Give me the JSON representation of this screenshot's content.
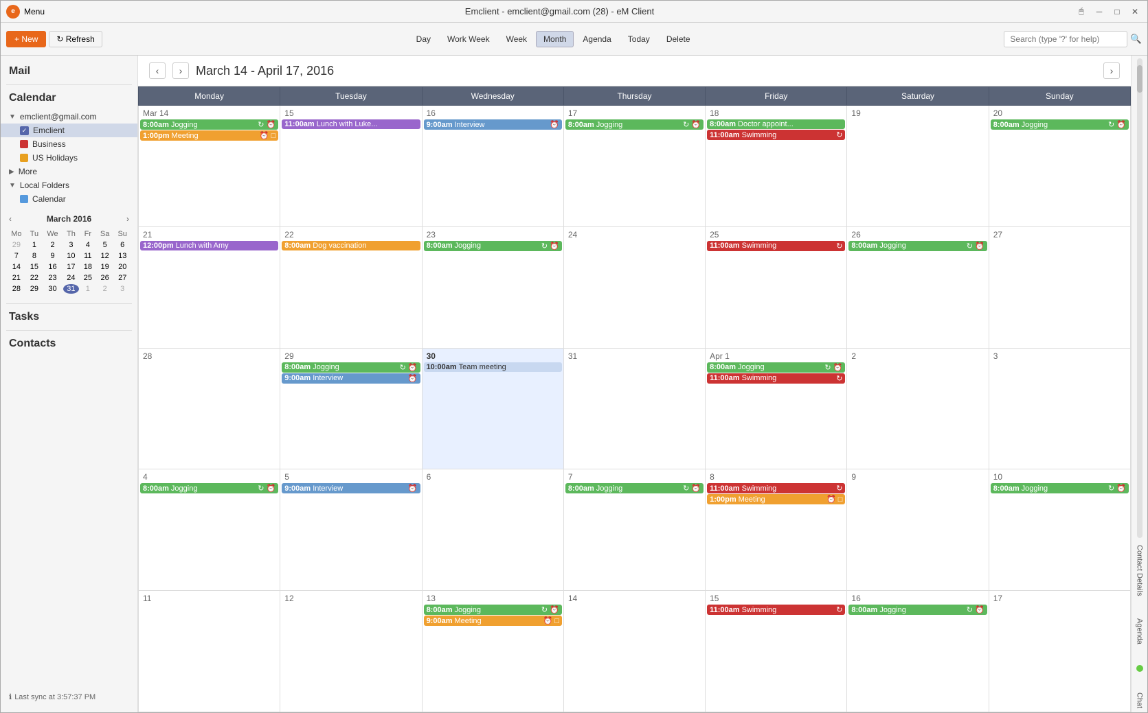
{
  "titleBar": {
    "appName": "eM Client",
    "title": "Emclient - emclient@gmail.com (28) - eM Client",
    "menuLabel": "Menu"
  },
  "toolbar": {
    "newLabel": "+ New",
    "refreshLabel": "↻ Refresh",
    "dayLabel": "Day",
    "workWeekLabel": "Work Week",
    "weekLabel": "Week",
    "monthLabel": "Month",
    "agendaLabel": "Agenda",
    "todayLabel": "Today",
    "deleteLabel": "Delete",
    "searchPlaceholder": "Search (type '?' for help)"
  },
  "sidebar": {
    "mailLabel": "Mail",
    "calendarLabel": "Calendar",
    "accountEmail": "emclient@gmail.com",
    "calendars": [
      {
        "name": "Emclient",
        "color": "#5566aa",
        "checked": true
      },
      {
        "name": "Business",
        "color": "#cc3333",
        "checked": true
      },
      {
        "name": "US Holidays",
        "color": "#e8a020",
        "checked": true
      }
    ],
    "moreLabel": "More",
    "localFoldersLabel": "Local Folders",
    "localCalendars": [
      {
        "name": "Calendar",
        "color": "#5599dd",
        "checked": true
      }
    ],
    "tasksLabel": "Tasks",
    "contactsLabel": "Contacts",
    "miniCal": {
      "title": "March 2016",
      "headers": [
        "Mo",
        "Tu",
        "We",
        "Th",
        "Fr",
        "Sa",
        "Su"
      ],
      "rows": [
        [
          "29",
          "1",
          "2",
          "3",
          "4",
          "5",
          "6"
        ],
        [
          "7",
          "8",
          "9",
          "10",
          "11",
          "12",
          "13"
        ],
        [
          "14",
          "15",
          "16",
          "17",
          "18",
          "19",
          "20"
        ],
        [
          "21",
          "22",
          "23",
          "24",
          "25",
          "26",
          "27"
        ],
        [
          "28",
          "29",
          "30",
          "31",
          "1",
          "2",
          "3"
        ]
      ],
      "today": "31"
    },
    "syncStatus": "Last sync at 3:57:37 PM"
  },
  "calendar": {
    "rangeTitle": "March 14 - April 17, 2016",
    "dayHeaders": [
      "Monday",
      "Tuesday",
      "Wednesday",
      "Thursday",
      "Friday",
      "Saturday",
      "Sunday"
    ],
    "weeks": [
      {
        "days": [
          {
            "date": "Mar 14",
            "events": [
              {
                "time": "8:00am",
                "title": "Jogging",
                "color": "green",
                "icons": [
                  "↻",
                  "⏰"
                ]
              },
              {
                "time": "1:00pm",
                "title": "Meeting",
                "color": "orange",
                "icons": [
                  "⏰",
                  "□"
                ]
              }
            ]
          },
          {
            "date": "15",
            "events": [
              {
                "time": "11:00am",
                "title": "Lunch with Luke...",
                "color": "purple",
                "icons": []
              }
            ]
          },
          {
            "date": "16",
            "events": [
              {
                "time": "9:00am",
                "title": "Interview",
                "color": "blue",
                "icons": [
                  "⏰"
                ]
              }
            ]
          },
          {
            "date": "17",
            "events": [
              {
                "time": "8:00am",
                "title": "Jogging",
                "color": "green",
                "icons": [
                  "↻",
                  "⏰"
                ]
              }
            ]
          },
          {
            "date": "18",
            "events": [
              {
                "time": "8:00am",
                "title": "Doctor appoint...",
                "color": "green",
                "icons": []
              },
              {
                "time": "11:00am",
                "title": "Swimming",
                "color": "red",
                "icons": [
                  "↻"
                ]
              }
            ]
          },
          {
            "date": "19",
            "events": []
          },
          {
            "date": "20",
            "events": [
              {
                "time": "8:00am",
                "title": "Jogging",
                "color": "green",
                "icons": [
                  "↻",
                  "⏰"
                ]
              }
            ]
          }
        ]
      },
      {
        "days": [
          {
            "date": "21",
            "events": [
              {
                "time": "12:00pm",
                "title": "Lunch with Amy",
                "color": "purple",
                "icons": []
              }
            ]
          },
          {
            "date": "22",
            "events": [
              {
                "time": "8:00am",
                "title": "Dog vaccination",
                "color": "orange",
                "icons": []
              }
            ]
          },
          {
            "date": "23",
            "events": [
              {
                "time": "8:00am",
                "title": "Jogging",
                "color": "green",
                "icons": [
                  "↻",
                  "⏰"
                ]
              }
            ]
          },
          {
            "date": "24",
            "events": []
          },
          {
            "date": "25",
            "events": [
              {
                "time": "11:00am",
                "title": "Swimming",
                "color": "red",
                "icons": [
                  "↻"
                ]
              }
            ]
          },
          {
            "date": "26",
            "events": [
              {
                "time": "8:00am",
                "title": "Jogging",
                "color": "green",
                "icons": [
                  "↻",
                  "⏰"
                ]
              }
            ]
          },
          {
            "date": "27",
            "events": []
          }
        ]
      },
      {
        "days": [
          {
            "date": "28",
            "events": []
          },
          {
            "date": "29",
            "events": [
              {
                "time": "8:00am",
                "title": "Jogging",
                "color": "green",
                "icons": [
                  "↻",
                  "⏰"
                ]
              },
              {
                "time": "9:00am",
                "title": "Interview",
                "color": "blue",
                "icons": [
                  "⏰"
                ]
              }
            ]
          },
          {
            "date": "30",
            "events": [
              {
                "time": "10:00am",
                "title": "Team meeting",
                "color": "light-blue",
                "icons": []
              }
            ],
            "isToday": true
          },
          {
            "date": "31",
            "events": []
          },
          {
            "date": "Apr 1",
            "events": [
              {
                "time": "8:00am",
                "title": "Jogging",
                "color": "green",
                "icons": [
                  "↻",
                  "⏰"
                ]
              },
              {
                "time": "11:00am",
                "title": "Swimming",
                "color": "red",
                "icons": [
                  "↻"
                ]
              }
            ]
          },
          {
            "date": "2",
            "events": []
          },
          {
            "date": "3",
            "events": []
          }
        ]
      },
      {
        "days": [
          {
            "date": "4",
            "events": [
              {
                "time": "8:00am",
                "title": "Jogging",
                "color": "green",
                "icons": [
                  "↻",
                  "⏰"
                ]
              }
            ]
          },
          {
            "date": "5",
            "events": [
              {
                "time": "9:00am",
                "title": "Interview",
                "color": "blue",
                "icons": [
                  "⏰"
                ]
              }
            ]
          },
          {
            "date": "6",
            "events": []
          },
          {
            "date": "7",
            "events": [
              {
                "time": "8:00am",
                "title": "Jogging",
                "color": "green",
                "icons": [
                  "↻",
                  "⏰"
                ]
              }
            ]
          },
          {
            "date": "8",
            "events": [
              {
                "time": "11:00am",
                "title": "Swimming",
                "color": "red",
                "icons": [
                  "↻"
                ]
              },
              {
                "time": "1:00pm",
                "title": "Meeting",
                "color": "orange",
                "icons": [
                  "⏰",
                  "□"
                ]
              }
            ]
          },
          {
            "date": "9",
            "events": []
          },
          {
            "date": "10",
            "events": [
              {
                "time": "8:00am",
                "title": "Jogging",
                "color": "green",
                "icons": [
                  "↻",
                  "⏰"
                ]
              }
            ]
          }
        ]
      },
      {
        "days": [
          {
            "date": "11",
            "events": []
          },
          {
            "date": "12",
            "events": []
          },
          {
            "date": "13",
            "events": [
              {
                "time": "8:00am",
                "title": "Jogging",
                "color": "green",
                "icons": [
                  "↻",
                  "⏰"
                ]
              },
              {
                "time": "9:00am",
                "title": "Meeting",
                "color": "orange",
                "icons": [
                  "⏰",
                  "□"
                ]
              }
            ]
          },
          {
            "date": "14",
            "events": []
          },
          {
            "date": "15",
            "events": [
              {
                "time": "11:00am",
                "title": "Swimming",
                "color": "red",
                "icons": [
                  "↻"
                ]
              }
            ]
          },
          {
            "date": "16",
            "events": [
              {
                "time": "8:00am",
                "title": "Jogging",
                "color": "green",
                "icons": [
                  "↻",
                  "⏰"
                ]
              }
            ]
          },
          {
            "date": "17",
            "events": []
          }
        ]
      }
    ]
  },
  "rightPanel": {
    "contactDetailsLabel": "Contact Details",
    "agendaLabel": "Agenda",
    "chatLabel": "Chat"
  }
}
